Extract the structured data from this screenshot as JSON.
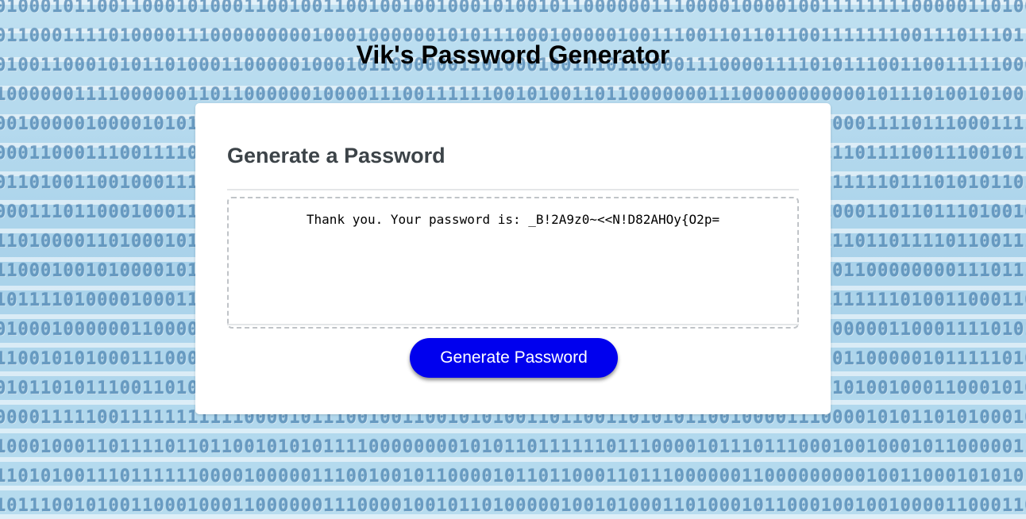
{
  "page": {
    "title": "Vik's Password Generator"
  },
  "card": {
    "heading": "Generate a Password",
    "password_output": "Thank you. Your password is: _B!2A9z0~<<N!D82AHOy{O2p=",
    "generate_button_label": "Generate Password"
  },
  "colors": {
    "button_background": "#0000ee",
    "button_text": "#ffffff",
    "card_background": "#ffffff",
    "heading_text": "#3c4348"
  }
}
